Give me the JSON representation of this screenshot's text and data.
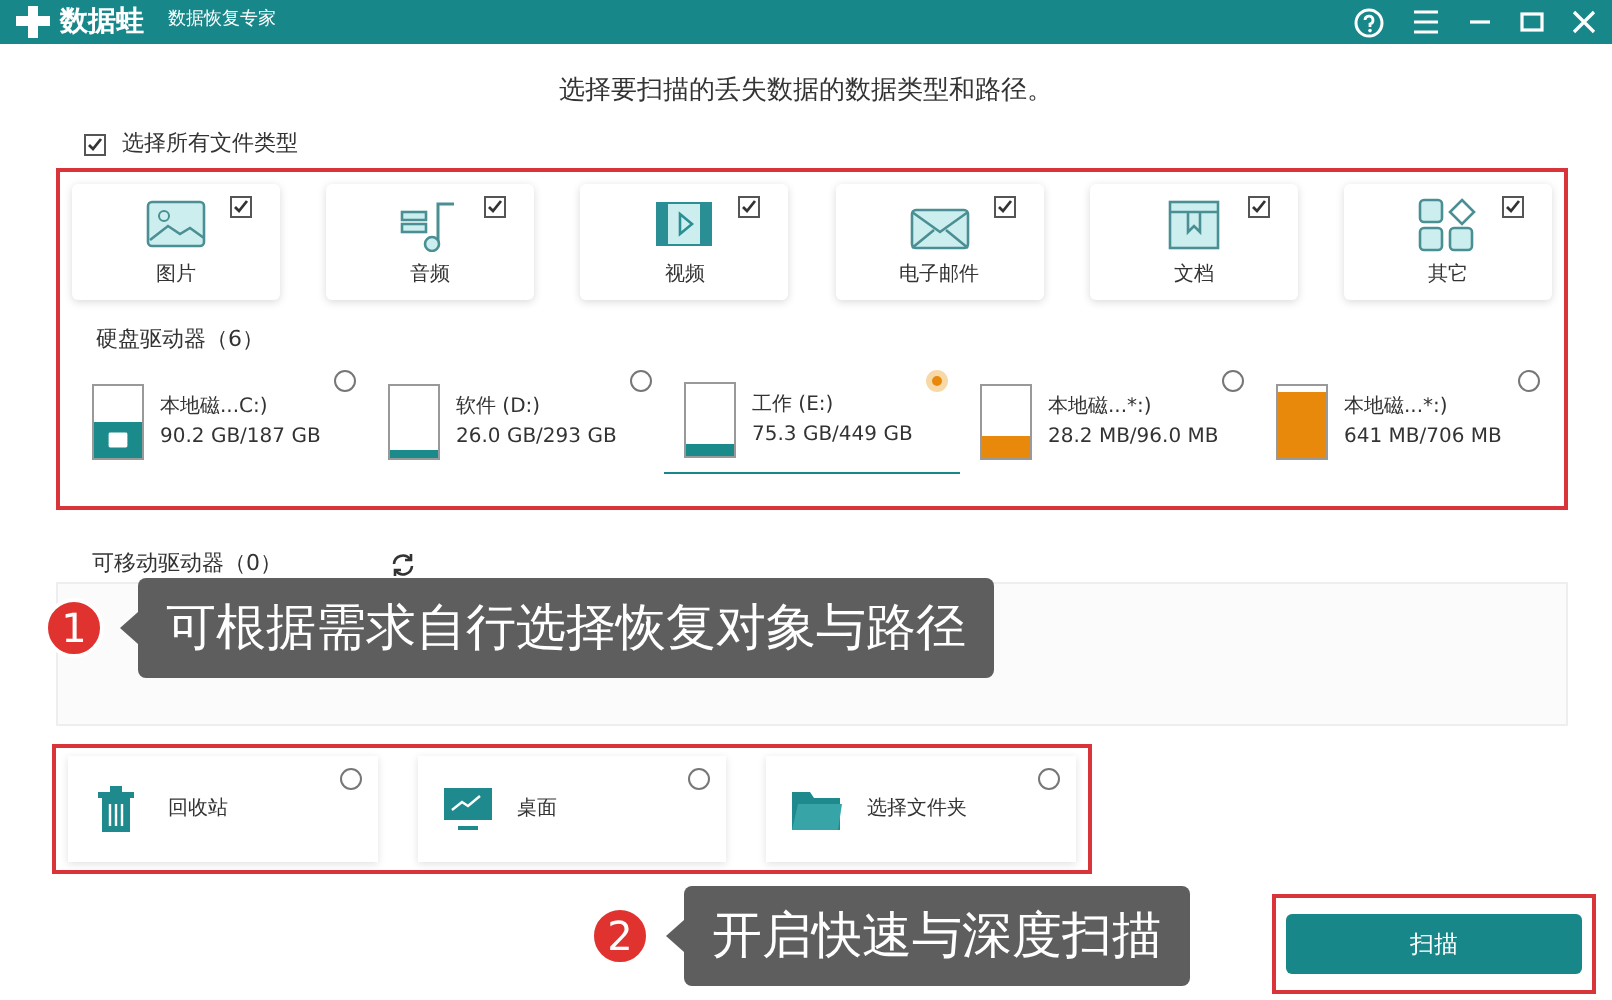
{
  "window": {
    "logo": "数据蛙",
    "subtitle": "数据恢复专家"
  },
  "heading": "选择要扫描的丢失数据的数据类型和路径。",
  "select_all": {
    "label": "选择所有文件类型",
    "checked": true
  },
  "file_types": [
    {
      "kind": "image",
      "label": "图片",
      "checked": true
    },
    {
      "kind": "audio",
      "label": "音频",
      "checked": true
    },
    {
      "kind": "video",
      "label": "视频",
      "checked": true
    },
    {
      "kind": "email",
      "label": "电子邮件",
      "checked": true
    },
    {
      "kind": "document",
      "label": "文档",
      "checked": true
    },
    {
      "kind": "other",
      "label": "其它",
      "checked": true
    }
  ],
  "hard_drives": {
    "label": "硬盘驱动器（6）",
    "items": [
      {
        "name": "本地磁...C:)",
        "usage": "90.2 GB/187 GB",
        "level": 0.48,
        "color": "#1a8a8a",
        "selected": false,
        "system": true
      },
      {
        "name": "软件 (D:)",
        "usage": "26.0 GB/293 GB",
        "level": 0.09,
        "color": "#1a8a8a",
        "selected": false,
        "system": false
      },
      {
        "name": "工作 (E:)",
        "usage": "75.3 GB/449 GB",
        "level": 0.17,
        "color": "#1a8a8a",
        "selected": true,
        "system": false
      },
      {
        "name": "本地磁...*:)",
        "usage": "28.2 MB/96.0 MB",
        "level": 0.29,
        "color": "#e8890c",
        "selected": false,
        "system": false
      },
      {
        "name": "本地磁...*:)",
        "usage": "641 MB/706 MB",
        "level": 0.91,
        "color": "#e8890c",
        "selected": false,
        "system": false
      }
    ]
  },
  "removable_drives": {
    "label": "可移动驱动器（0）"
  },
  "locations": [
    {
      "kind": "recycle",
      "label": "回收站",
      "selected": false
    },
    {
      "kind": "desktop",
      "label": "桌面",
      "selected": false
    },
    {
      "kind": "folder",
      "label": "选择文件夹",
      "selected": false
    }
  ],
  "annotations": [
    {
      "number": "1",
      "text": "可根据需求自行选择恢复对象与路径"
    },
    {
      "number": "2",
      "text": "开启快速与深度扫描"
    }
  ],
  "scan_button": "扫描"
}
